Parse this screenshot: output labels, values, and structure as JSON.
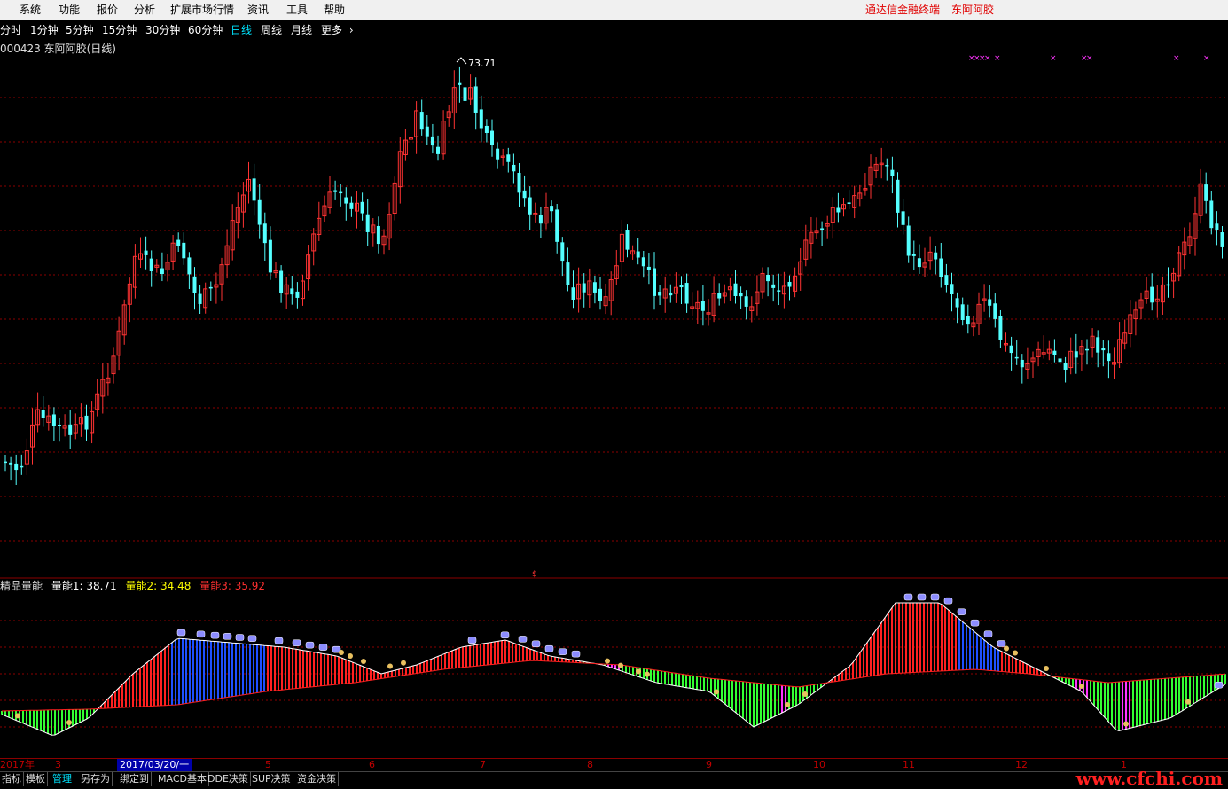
{
  "menu": {
    "items": [
      "系统",
      "功能",
      "报价",
      "分析",
      "扩展市场行情",
      "资讯",
      "工具",
      "帮助"
    ]
  },
  "brand": {
    "app": "通达信金融终端",
    "stock": "东阿阿胶"
  },
  "periods": {
    "items": [
      "分时",
      "1分钟",
      "5分钟",
      "15分钟",
      "30分钟",
      "60分钟",
      "日线",
      "周线",
      "月线",
      "更多"
    ],
    "active": "日线",
    "more_icon": "chevron-right-icon"
  },
  "stock": {
    "title": "000423 东阿阿胶(日线)",
    "high_label": "73.71"
  },
  "indicator": {
    "name": "精品量能",
    "l1": "量能1: 38.71",
    "l2": "量能2: 34.48",
    "l3": "量能3: 35.92",
    "colors": {
      "l1": "#ffffff",
      "l2": "#ffff00",
      "l3": "#ff3030"
    }
  },
  "dates": {
    "labels": [
      "2017年",
      "3",
      "5",
      "6",
      "7",
      "8",
      "9",
      "10",
      "11",
      "12",
      "1"
    ],
    "cursor": "2017/03/20/一"
  },
  "tabs": {
    "items": [
      "指标",
      "模板",
      "管理",
      "另存为",
      "绑定到",
      "MACD基本",
      "DDE决策",
      "SUP决策",
      "资金决策"
    ],
    "active": "管理"
  },
  "watermark": "www.cfchi.com",
  "colors": {
    "up": "#ff3333",
    "down": "#54ffff",
    "grid": "#8b0000",
    "bar_red": "#ff2020",
    "bar_blue": "#1e50ff",
    "bar_green": "#33ff33",
    "bar_magenta": "#ff33ff",
    "marker": "#ff33ff"
  }
}
